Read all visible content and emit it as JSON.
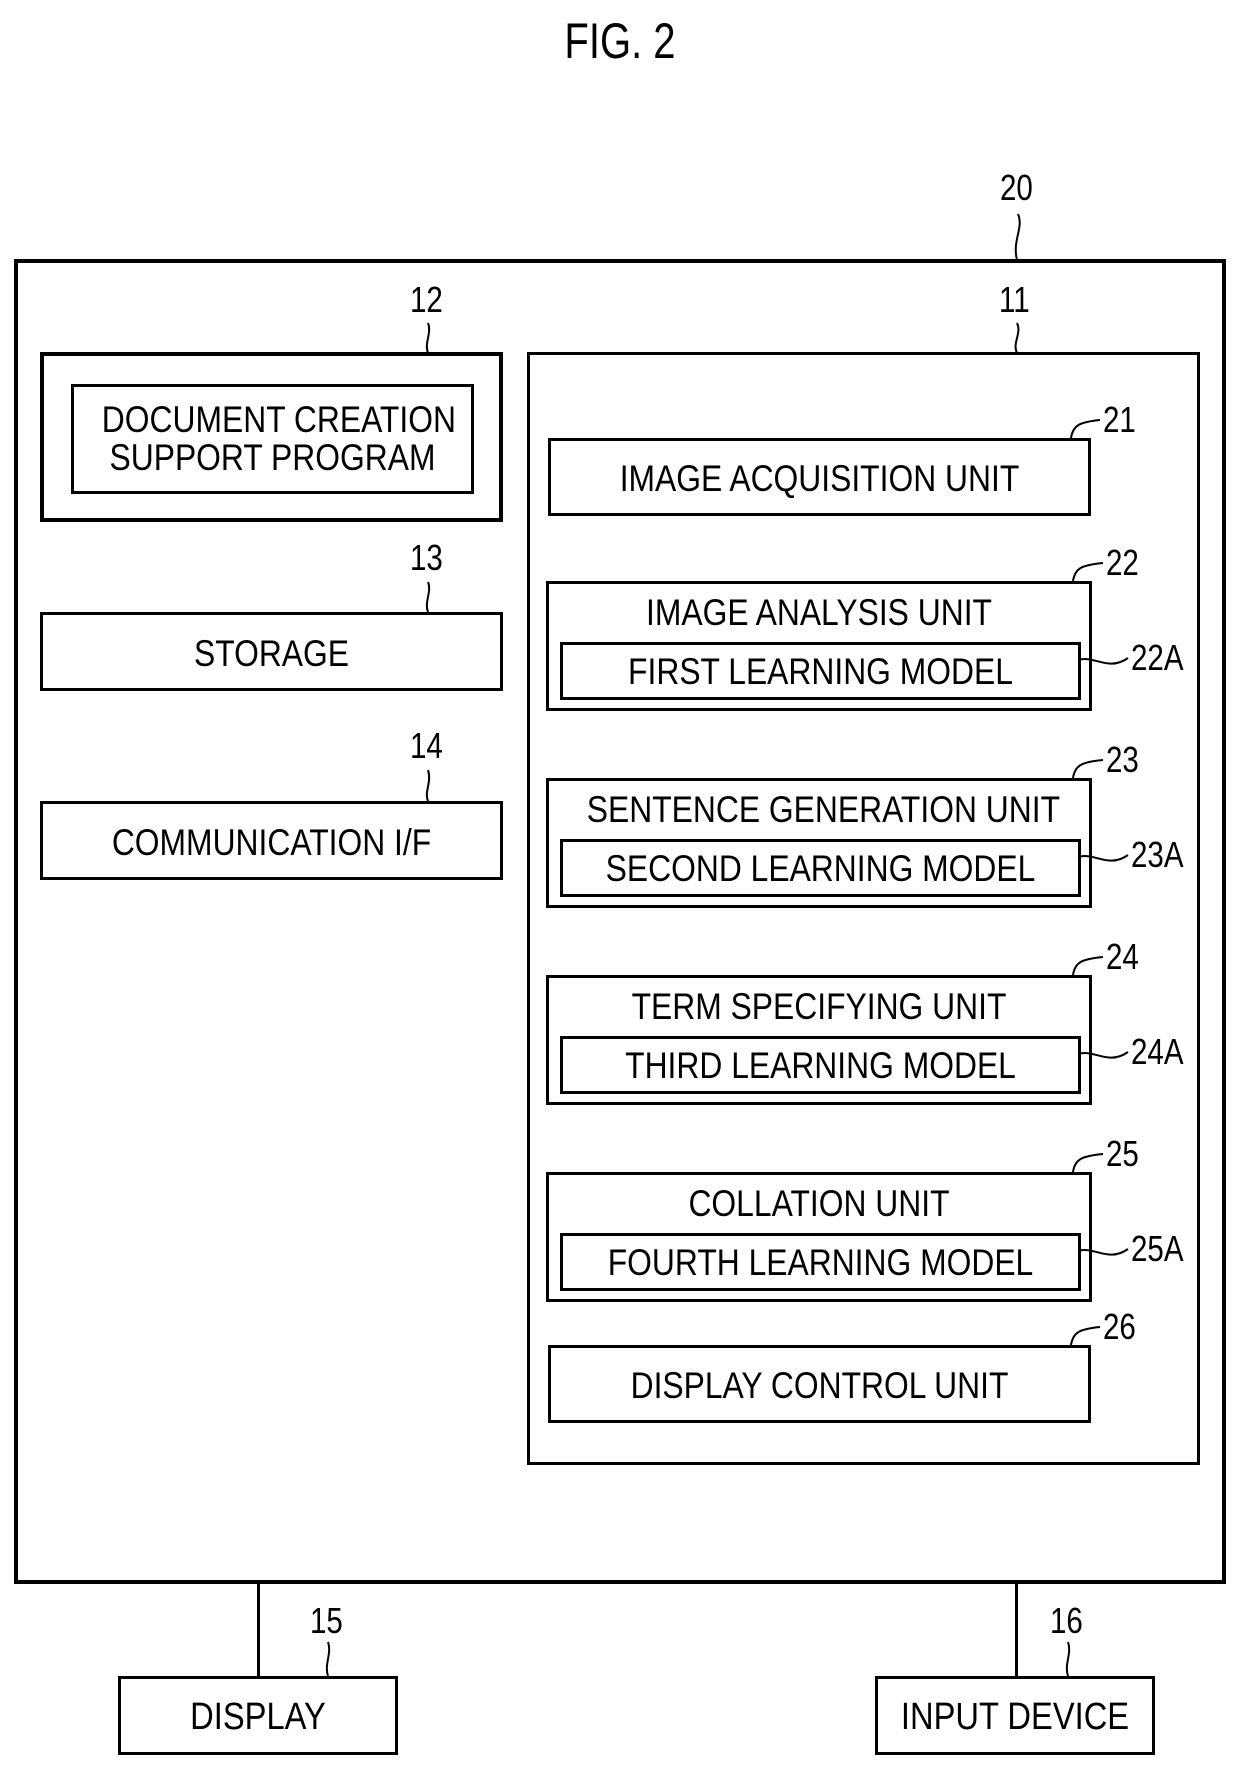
{
  "figure": {
    "title": "FIG. 2",
    "device": {
      "ref": "20"
    },
    "left_column": [
      {
        "ref": "12",
        "label_lines": [
          "DOCUMENT CREATION",
          "SUPPORT PROGRAM"
        ]
      },
      {
        "ref": "13",
        "label": "STORAGE"
      },
      {
        "ref": "14",
        "label": "COMMUNICATION I/F"
      }
    ],
    "processor": {
      "ref": "11",
      "units": [
        {
          "ref": "21",
          "label": "IMAGE ACQUISITION UNIT"
        },
        {
          "ref": "22",
          "label": "IMAGE ANALYSIS UNIT",
          "model": {
            "ref": "22A",
            "label": "FIRST LEARNING MODEL"
          }
        },
        {
          "ref": "23",
          "label": "SENTENCE GENERATION UNIT",
          "model": {
            "ref": "23A",
            "label": "SECOND LEARNING MODEL"
          }
        },
        {
          "ref": "24",
          "label": "TERM SPECIFYING UNIT",
          "model": {
            "ref": "24A",
            "label": "THIRD LEARNING MODEL"
          }
        },
        {
          "ref": "25",
          "label": "COLLATION UNIT",
          "model": {
            "ref": "25A",
            "label": "FOURTH LEARNING MODEL"
          }
        },
        {
          "ref": "26",
          "label": "DISPLAY CONTROL UNIT"
        }
      ]
    },
    "external": [
      {
        "ref": "15",
        "label": "DISPLAY"
      },
      {
        "ref": "16",
        "label": "INPUT DEVICE"
      }
    ]
  }
}
